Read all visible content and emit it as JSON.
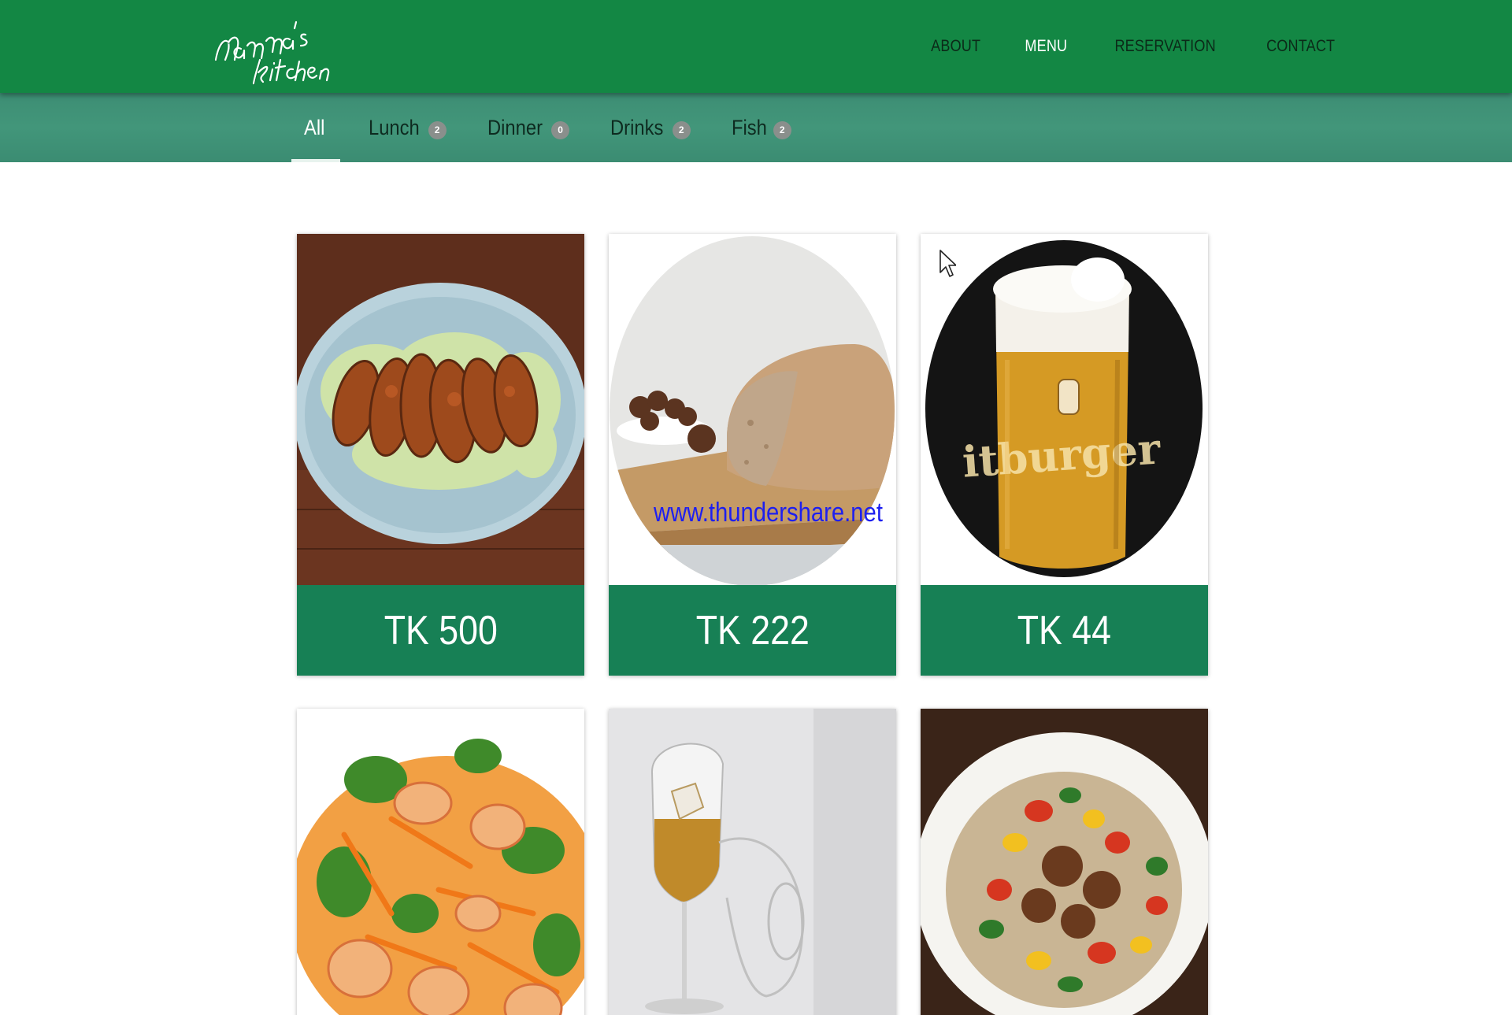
{
  "brand": {
    "logo_text_line1": "Mamma's",
    "logo_text_line2": "Kitchen"
  },
  "nav": {
    "items": [
      {
        "label": "ABOUT",
        "active": false
      },
      {
        "label": "MENU",
        "active": true
      },
      {
        "label": "RESERVATION",
        "active": false
      },
      {
        "label": "CONTACT",
        "active": false
      }
    ]
  },
  "filters": {
    "tabs": [
      {
        "label": "All",
        "count": null,
        "active": true
      },
      {
        "label": "Lunch",
        "count": "2",
        "active": false
      },
      {
        "label": "Dinner",
        "count": "0",
        "active": false
      },
      {
        "label": "Drinks",
        "count": "2",
        "active": false
      },
      {
        "label": "Fish",
        "count": "2",
        "active": false
      }
    ]
  },
  "menu_items": [
    {
      "price": "TK 500",
      "image": "grilled-meat-on-lettuce-plate"
    },
    {
      "price": "TK 222",
      "image": "bread-loaf-with-olives"
    },
    {
      "price": "TK 44",
      "image": "bitburger-beer-glass"
    },
    {
      "price": "",
      "image": "shrimp-carrot-salad"
    },
    {
      "price": "",
      "image": "whiskey-glass-with-ice"
    },
    {
      "price": "",
      "image": "vegetable-rice-bowl"
    }
  ],
  "watermark": {
    "text": "www.thundershare.net"
  },
  "colors": {
    "navbar": "#138744",
    "tabbar": "#42967a",
    "price_bar": "#178055",
    "badge": "#8a8f8c"
  }
}
